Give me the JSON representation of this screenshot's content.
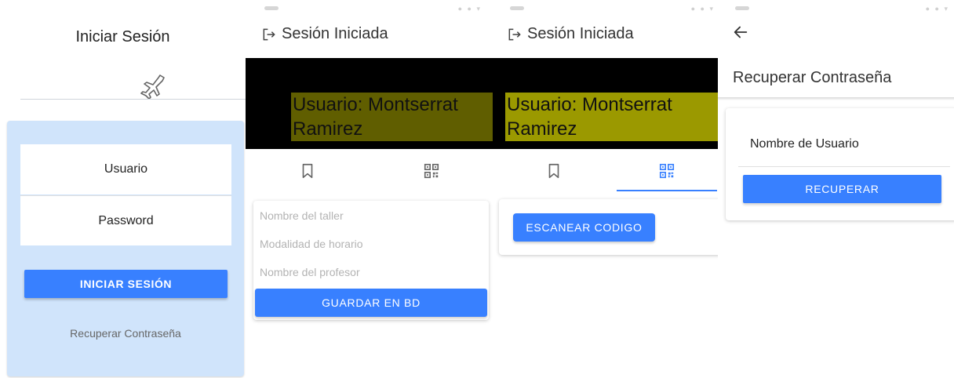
{
  "login": {
    "title": "Iniciar Sesión",
    "logo_icon": "airplane-icon",
    "username_label": "Usuario",
    "password_label": "Password",
    "login_button": "INICIAR SESIÓN",
    "recover_link": "Recuperar Contraseña"
  },
  "session_form": {
    "status_icons": "● ● ▾",
    "toolbar_icon": "logout-icon",
    "toolbar_title": "Sesión Iniciada",
    "user_banner_line1": "Usuario: Montserrat",
    "user_banner_line2": "Ramirez",
    "tabs": [
      {
        "icon": "bookmark-icon",
        "selected": true
      },
      {
        "icon": "qr-code-icon",
        "selected": false
      }
    ],
    "placeholders": [
      "Nombre del taller",
      "Modalidad de horario",
      "Nombre del profesor"
    ],
    "save_button": "GUARDAR EN BD"
  },
  "session_scan": {
    "status_icons": "● ● ▾",
    "toolbar_icon": "logout-icon",
    "toolbar_title": "Sesión Iniciada",
    "user_banner_line1": "Usuario: Montserrat",
    "user_banner_line2": "Ramirez",
    "tabs": [
      {
        "icon": "bookmark-icon",
        "selected": false
      },
      {
        "icon": "qr-code-icon",
        "selected": true
      }
    ],
    "scan_button": "ESCANEAR CODIGO"
  },
  "recover": {
    "status_icons": "● ● ▾",
    "back_icon": "back-arrow-icon",
    "title": "Recuperar Contraseña",
    "username_label": "Nombre de Usuario",
    "recover_button": "RECUPERAR"
  },
  "colors": {
    "primary": "#3880ff",
    "login_card": "#d0e4fb",
    "banner_bg": "#000000",
    "user_highlight_dark": "#605e00",
    "user_highlight_light": "#9b9900",
    "selected_tab_icon": "#3880ff",
    "unselected_tab_icon": "#666666"
  }
}
